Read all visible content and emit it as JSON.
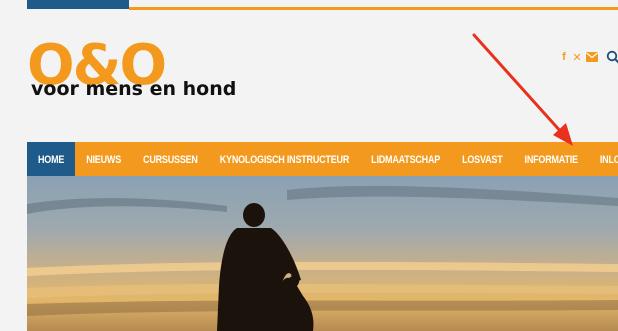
{
  "logo": {
    "mark": "O&O",
    "tagline": "voor mens en hond"
  },
  "social": {
    "icons": [
      "facebook-icon",
      "x-icon",
      "mail-icon",
      "search-icon"
    ],
    "facebook_glyph": "f",
    "x_glyph": "✕"
  },
  "nav": {
    "items": [
      {
        "label": "HOME",
        "active": true
      },
      {
        "label": "NIEUWS"
      },
      {
        "label": "CURSUSSEN"
      },
      {
        "label": "KYNOLOGISCH INSTRUCTEUR"
      },
      {
        "label": "LIDMAATSCHAP"
      },
      {
        "label": "LOSVAST"
      },
      {
        "label": "INFORMATIE"
      },
      {
        "label": "INLOGGEN"
      }
    ]
  },
  "colors": {
    "accent": "#f39a1e",
    "active": "#1f5b8a",
    "annotation": "#e8321e"
  }
}
